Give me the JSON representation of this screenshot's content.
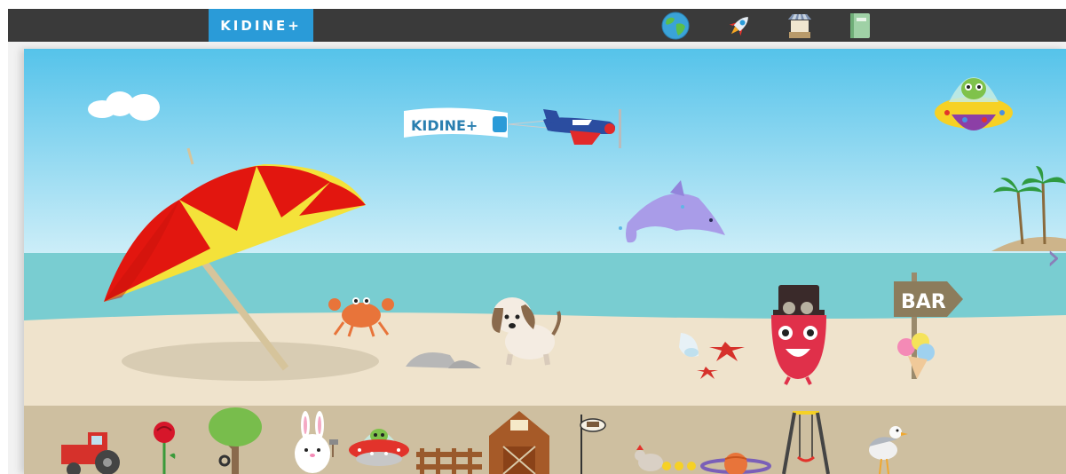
{
  "app": {
    "brand": "KIDINE+",
    "banner_text": "KIDINE+"
  },
  "nav": {
    "items": [
      {
        "name": "earth-world",
        "icon": "globe-icon"
      },
      {
        "name": "space-world",
        "icon": "rocket-icon"
      },
      {
        "name": "shop-world",
        "icon": "market-stall-icon"
      },
      {
        "name": "story-book",
        "icon": "notebook-icon"
      }
    ]
  },
  "scene": {
    "name": "beach",
    "sign_text": "BAR",
    "next_arrow": "›",
    "colors": {
      "sky_top": "#55c3ea",
      "sky_bottom": "#cdeef8",
      "sea": "#79cdd1",
      "sand": "#efe3cc",
      "ground": "#cebfa0"
    }
  },
  "item_bank": [
    "tractor",
    "rose",
    "tree",
    "bunny",
    "alien-ufo",
    "fence",
    "barn",
    "sign-post",
    "hen-chicks",
    "planet",
    "swing",
    "seagull"
  ]
}
